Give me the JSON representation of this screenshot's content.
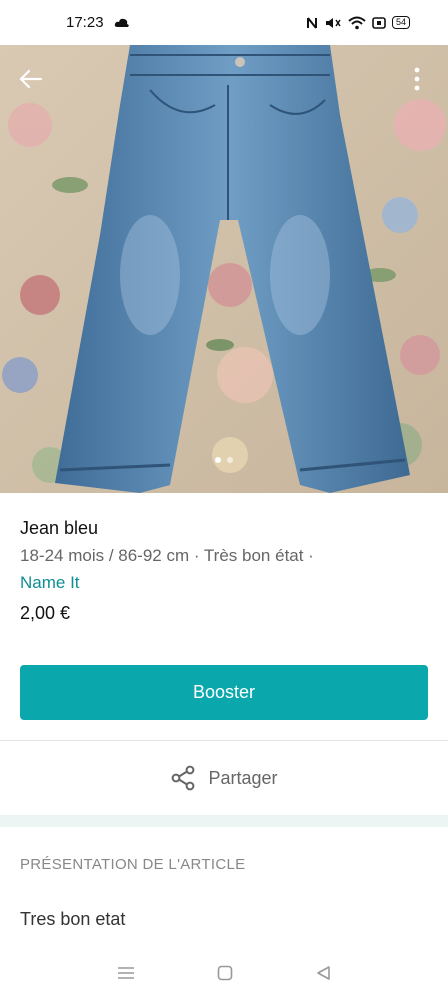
{
  "status_bar": {
    "time": "17:23",
    "battery": "54"
  },
  "item": {
    "title": "Jean bleu",
    "meta": "18-24 mois / 86-92 cm · Très bon état ·",
    "brand": "Name It",
    "price": "2,00 €"
  },
  "actions": {
    "booster_label": "Booster",
    "share_label": "Partager"
  },
  "section": {
    "title": "PRÉSENTATION DE L'ARTICLE",
    "description": "Tres bon etat"
  },
  "carousel": {
    "total": 2,
    "active_index": 0
  },
  "colors": {
    "accent": "#0aa8ad",
    "brand_text": "#0f8e93"
  },
  "icons": [
    "back-arrow-icon",
    "more-vertical-icon",
    "share-icon",
    "cloud-icon",
    "nfc-icon",
    "mute-icon",
    "wifi-icon",
    "battery-icon",
    "menu-icon",
    "home-icon",
    "back-icon"
  ]
}
